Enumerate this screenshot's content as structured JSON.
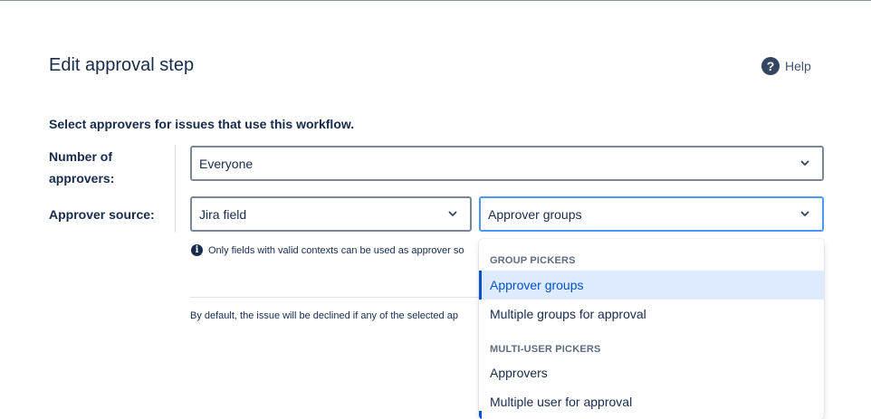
{
  "page": {
    "title": "Edit approval step",
    "help_label": "Help",
    "help_icon": "question-circle-icon",
    "intro": "Select approvers for issues that use this workflow."
  },
  "form": {
    "number_label_line1": "Number of",
    "number_label_line2": "approvers:",
    "number_value": "Everyone",
    "source_label": "Approver source:",
    "source_value": "Jira field",
    "field_value": "Approver groups",
    "info_text": "Only fields with valid contexts can be used as approver so",
    "footer_text": "By default, the issue will be declined if any of the selected ap"
  },
  "dropdown": {
    "groups": [
      {
        "title": "GROUP PICKERS",
        "options": [
          {
            "label": "Approver groups",
            "selected": true
          },
          {
            "label": "Multiple groups for approval",
            "selected": false
          }
        ]
      },
      {
        "title": "MULTI-USER PICKERS",
        "options": [
          {
            "label": "Approvers",
            "selected": false
          },
          {
            "label": "Multiple user for approval",
            "selected": false
          }
        ]
      }
    ]
  },
  "colors": {
    "text": "#172b4d",
    "selected_bg": "#deebff",
    "selected_text": "#0052cc",
    "focus_border": "#4c9aff",
    "default_border": "#7a869a"
  }
}
